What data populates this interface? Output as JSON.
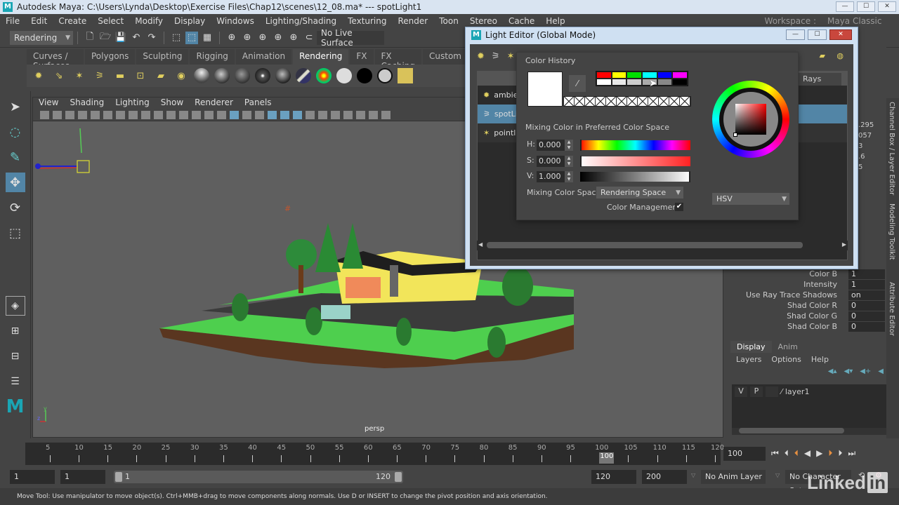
{
  "window": {
    "title": "Autodesk Maya: C:\\Users\\Lynda\\Desktop\\Exercise Files\\Chap12\\scenes\\12_08.ma*  ---  spotLight1",
    "logo": "M",
    "controls": {
      "minimize": "—",
      "maximize": "☐",
      "close": "✕"
    }
  },
  "menubar": [
    "File",
    "Edit",
    "Create",
    "Select",
    "Modify",
    "Display",
    "Windows",
    "Lighting/Shading",
    "Texturing",
    "Render",
    "Toon",
    "Stereo",
    "Cache",
    "Help"
  ],
  "statusline": {
    "menuset": "Rendering",
    "live_surface": "No Live Surface",
    "workspace_label": "Workspace :",
    "workspace_value": "Maya Classic"
  },
  "shelf": {
    "tabs": [
      "Curves / Surfaces",
      "Polygons",
      "Sculpting",
      "Rigging",
      "Animation",
      "Rendering",
      "FX",
      "FX Caching",
      "Custom"
    ],
    "active_tab": "Rendering"
  },
  "viewport": {
    "menus": [
      "View",
      "Shading",
      "Lighting",
      "Show",
      "Renderer",
      "Panels"
    ],
    "camera_label": "persp",
    "axis_labels": {
      "y": "y",
      "z": "z"
    }
  },
  "light_editor": {
    "title": "Light Editor (Global Mode)",
    "logo": "M",
    "controls": {
      "minimize": "—",
      "maximize": "☐",
      "close": "✕"
    },
    "column_partial": "Rays",
    "lights": [
      {
        "name": "ambie",
        "icon": "ambient-light-icon",
        "selected": false
      },
      {
        "name": "spotLi",
        "icon": "spot-light-icon",
        "selected": true
      },
      {
        "name": "pointl",
        "icon": "point-light-icon",
        "selected": false
      }
    ]
  },
  "color_picker": {
    "history_label": "Color History",
    "current_color": "#ffffff",
    "history_colors": [
      "#ff0000",
      "#ffff00",
      "#00e000",
      "#00ffff",
      "#0000ff",
      "#ff00ff",
      "#ffffff",
      "#e8e8e8",
      "#cccccc",
      "#aaaaaa",
      "#888888",
      "#000000"
    ],
    "mixing_label": "Mixing Color in Preferred Color Space",
    "h_label": "H:",
    "h_value": "0.000",
    "s_label": "S:",
    "s_value": "0.000",
    "v_label": "V:",
    "v_value": "1.000",
    "mixing_space_label": "Mixing Color Space:",
    "mixing_space_value": "Rendering Space",
    "color_management_label": "Color Management",
    "color_management_checked": true,
    "wheel_mode": "HSV"
  },
  "channel_box": {
    "partial_values": [
      ".295",
      "057",
      "3",
      ".6",
      "5"
    ],
    "attributes": [
      {
        "label": "Color B",
        "value": "1"
      },
      {
        "label": "Intensity",
        "value": "1"
      },
      {
        "label": "Use Ray Trace Shadows",
        "value": "on"
      },
      {
        "label": "Shad Color R",
        "value": "0"
      },
      {
        "label": "Shad Color G",
        "value": "0"
      },
      {
        "label": "Shad Color B",
        "value": "0"
      }
    ]
  },
  "side_tabs": [
    "Channel Box / Layer Editor",
    "Modeling Toolkit",
    "Attribute Editor"
  ],
  "layer_editor": {
    "tabs": [
      "Display",
      "Anim"
    ],
    "menus": [
      "Layers",
      "Options",
      "Help"
    ],
    "layers": [
      {
        "v": "V",
        "p": "P",
        "name": "layer1"
      }
    ]
  },
  "timeline": {
    "ticks": [
      5,
      10,
      15,
      20,
      25,
      30,
      35,
      40,
      45,
      50,
      55,
      60,
      65,
      70,
      75,
      80,
      85,
      90,
      95,
      100,
      105,
      110,
      115,
      120
    ],
    "current_frame_marker": "100",
    "current_frame": "100",
    "start": 1,
    "end": 120
  },
  "range": {
    "start_time": "1",
    "playback_start": "1",
    "slider_start": "1",
    "slider_end": "120",
    "playback_end": "120",
    "end_time": "200",
    "anim_layer": "No Anim Layer",
    "character_set": "No Character Set"
  },
  "help_line": "Move Tool: Use manipulator to move object(s). Ctrl+MMB+drag to move components along normals. Use D or INSERT to change the pivot position and axis orientation.",
  "watermark": {
    "text": "Linked",
    "in": "in"
  }
}
